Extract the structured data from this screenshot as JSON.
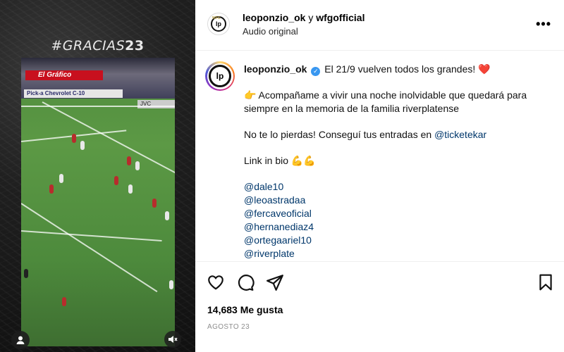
{
  "media": {
    "hashtag_prefix": "#GRACIAS",
    "hashtag_number": "23",
    "banner1_text": "El Gráfico",
    "banner2_text": "Pick-a Chevrolet C-10",
    "banner3_text": "JVC",
    "volume_icon": "muted-speaker-icon",
    "user_icon": "person-icon"
  },
  "header": {
    "owner1": "leoponzio_ok",
    "joiner": "y",
    "owner2": "wfgofficial",
    "audio_label": "Audio original",
    "more_label": "•••"
  },
  "caption": {
    "username": "leoponzio_ok",
    "line1": "El 21/9 vuelven todos los grandes! ❤️",
    "line2": "👉 Acompañame a vivir una noche inolvidable que quedará para siempre en la memoria de la familia riverplatense",
    "line3_text": "No te lo pierdas! Conseguí tus entradas en ",
    "line3_link": "@ticketekar",
    "line4": "Link in bio 💪💪",
    "mentions": [
      "@dale10",
      "@leoastradaa",
      "@fercaveoficial",
      "@hernanediaz4",
      "@ortegaariel10",
      "@riverplate"
    ]
  },
  "stats": {
    "likes": "14,683 Me gusta",
    "date": "AGOSTO 23"
  },
  "colors": {
    "link": "#00376b",
    "verified": "#3897f0",
    "secondary_text": "#8e8e8e"
  }
}
